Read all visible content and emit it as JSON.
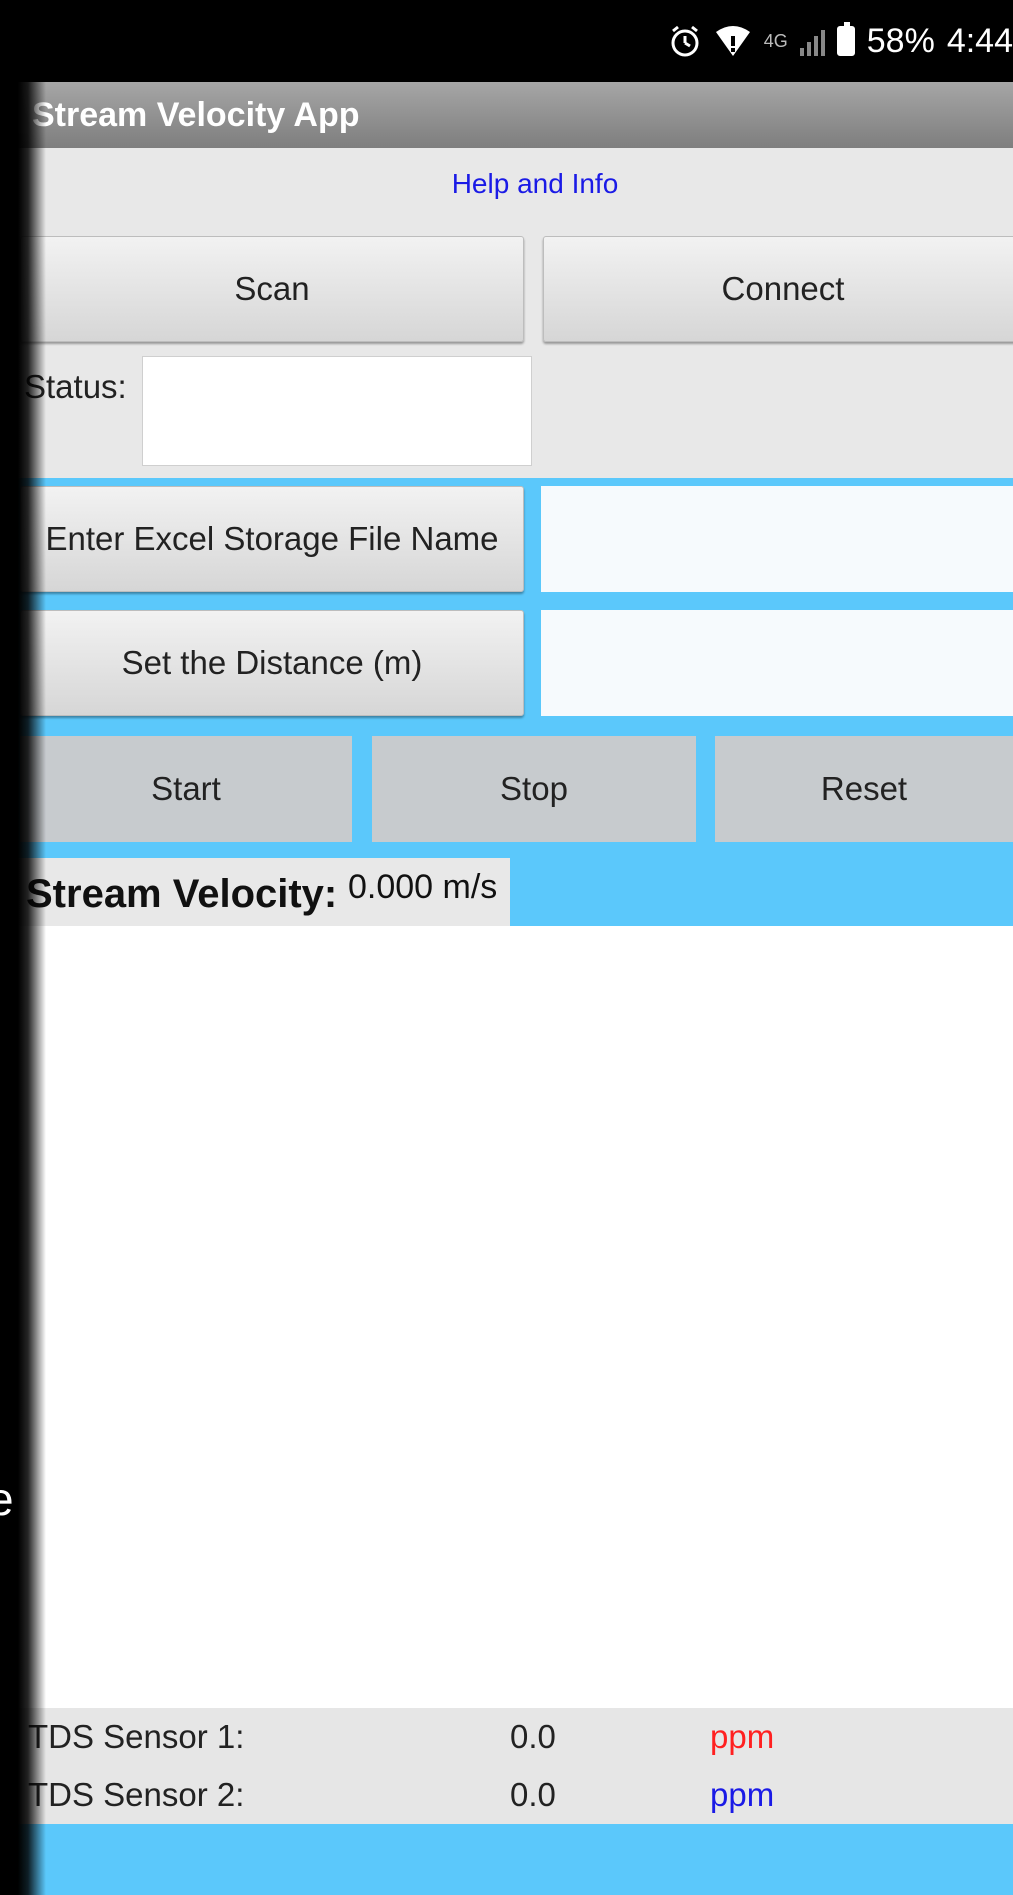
{
  "status_bar": {
    "battery": "58%",
    "time": "4:44",
    "network": "4G",
    "icons": [
      "alarm-icon",
      "wifi-icon",
      "signal-icon",
      "battery-icon"
    ]
  },
  "app": {
    "title": "Stream Velocity App",
    "help_link": "Help and Info"
  },
  "buttons": {
    "scan": "Scan",
    "connect": "Connect",
    "file_name": "Enter Excel Storage File Name",
    "distance": "Set the Distance (m)",
    "start": "Start",
    "stop": "Stop",
    "reset": "Reset"
  },
  "status": {
    "label": "Status:",
    "value": ""
  },
  "fields": {
    "file_name_value": "",
    "distance_value": ""
  },
  "velocity": {
    "label": "Stream Velocity:",
    "value": "0.000 m/s"
  },
  "sensors": [
    {
      "label": "TDS Sensor 1:",
      "value": "0.0",
      "unit": "ppm",
      "unit_color": "#ff2020"
    },
    {
      "label": "TDS Sensor 2:",
      "value": "0.0",
      "unit": "ppm",
      "unit_color": "#1a1ae6"
    }
  ],
  "colors": {
    "accent_blue": "#5bc8fb",
    "link": "#1a1ae6"
  },
  "stray_char": "e"
}
